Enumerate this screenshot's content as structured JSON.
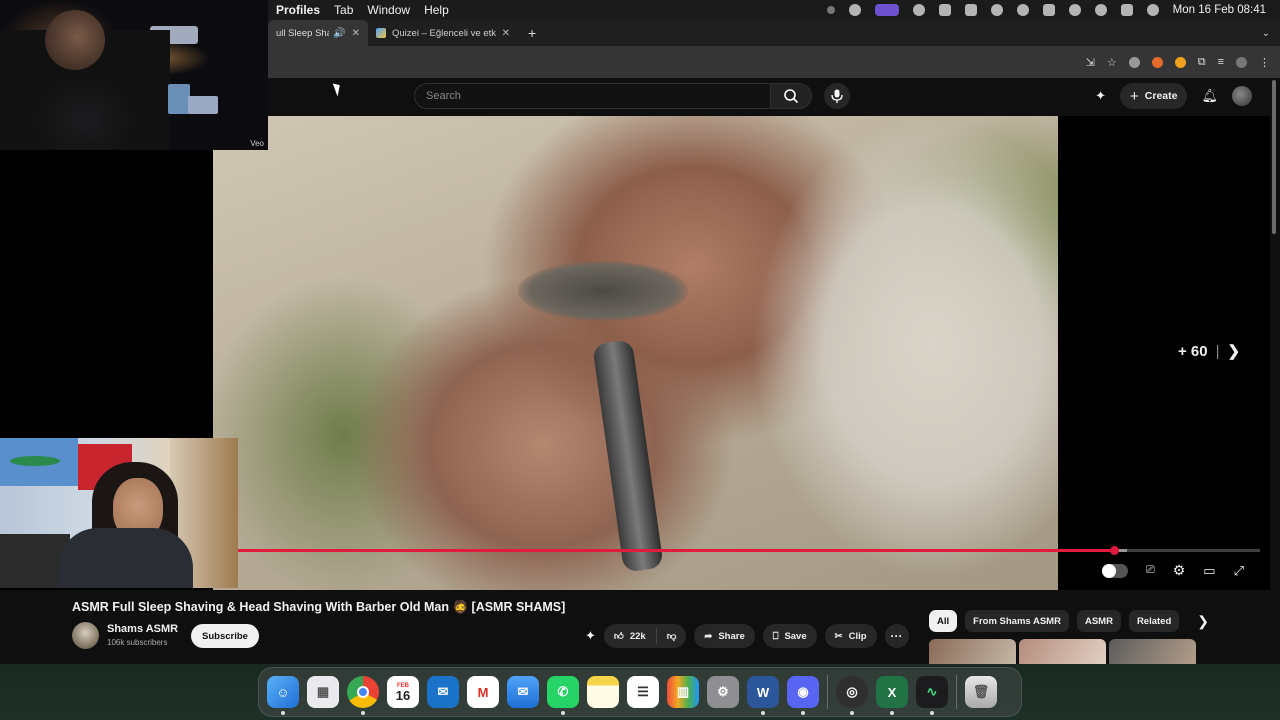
{
  "menubar": {
    "items": [
      "Profiles",
      "Tab",
      "Window",
      "Help"
    ],
    "clock": "Mon 16 Feb  08:41"
  },
  "tabs": [
    {
      "label": "ull Sleep Shaving",
      "active": true,
      "audio": true
    },
    {
      "label": "Quizei – Eğlenceli ve etkileşim",
      "active": false
    }
  ],
  "header": {
    "search_placeholder": "Search",
    "create_label": "Create"
  },
  "player": {
    "skip_label": "+ 60",
    "progress": {
      "played": 0.857,
      "buffered": 0.87
    }
  },
  "webcam": {
    "badge": "Veo"
  },
  "video": {
    "title": "ASMR Full Sleep Shaving & Head Shaving With Barber Old Man 🧔 [ASMR SHAMS]",
    "channel": "Shams ASMR",
    "subscribers": "106k subscribers",
    "subscribe_label": "Subscribe",
    "likes": "22k",
    "share_label": "Share",
    "save_label": "Save",
    "clip_label": "Clip"
  },
  "chips": [
    "All",
    "From Shams ASMR",
    "ASMR",
    "Related"
  ],
  "dock": {
    "calendar_month": "FEB",
    "calendar_day": "16",
    "apps": [
      "finder-icon",
      "launchpad-icon",
      "chrome-icon",
      "calendar-icon",
      "outlook-icon",
      "gmail-icon",
      "mail-icon",
      "whatsapp-icon",
      "notes-icon",
      "reminders-icon",
      "books-icon",
      "settings-icon",
      "word-icon",
      "discord-icon",
      "obs-icon",
      "excel-icon",
      "activity-monitor-icon",
      "trash-icon"
    ]
  },
  "colors": {
    "accent": "#e21b3c",
    "background": "#0f0f0f"
  }
}
